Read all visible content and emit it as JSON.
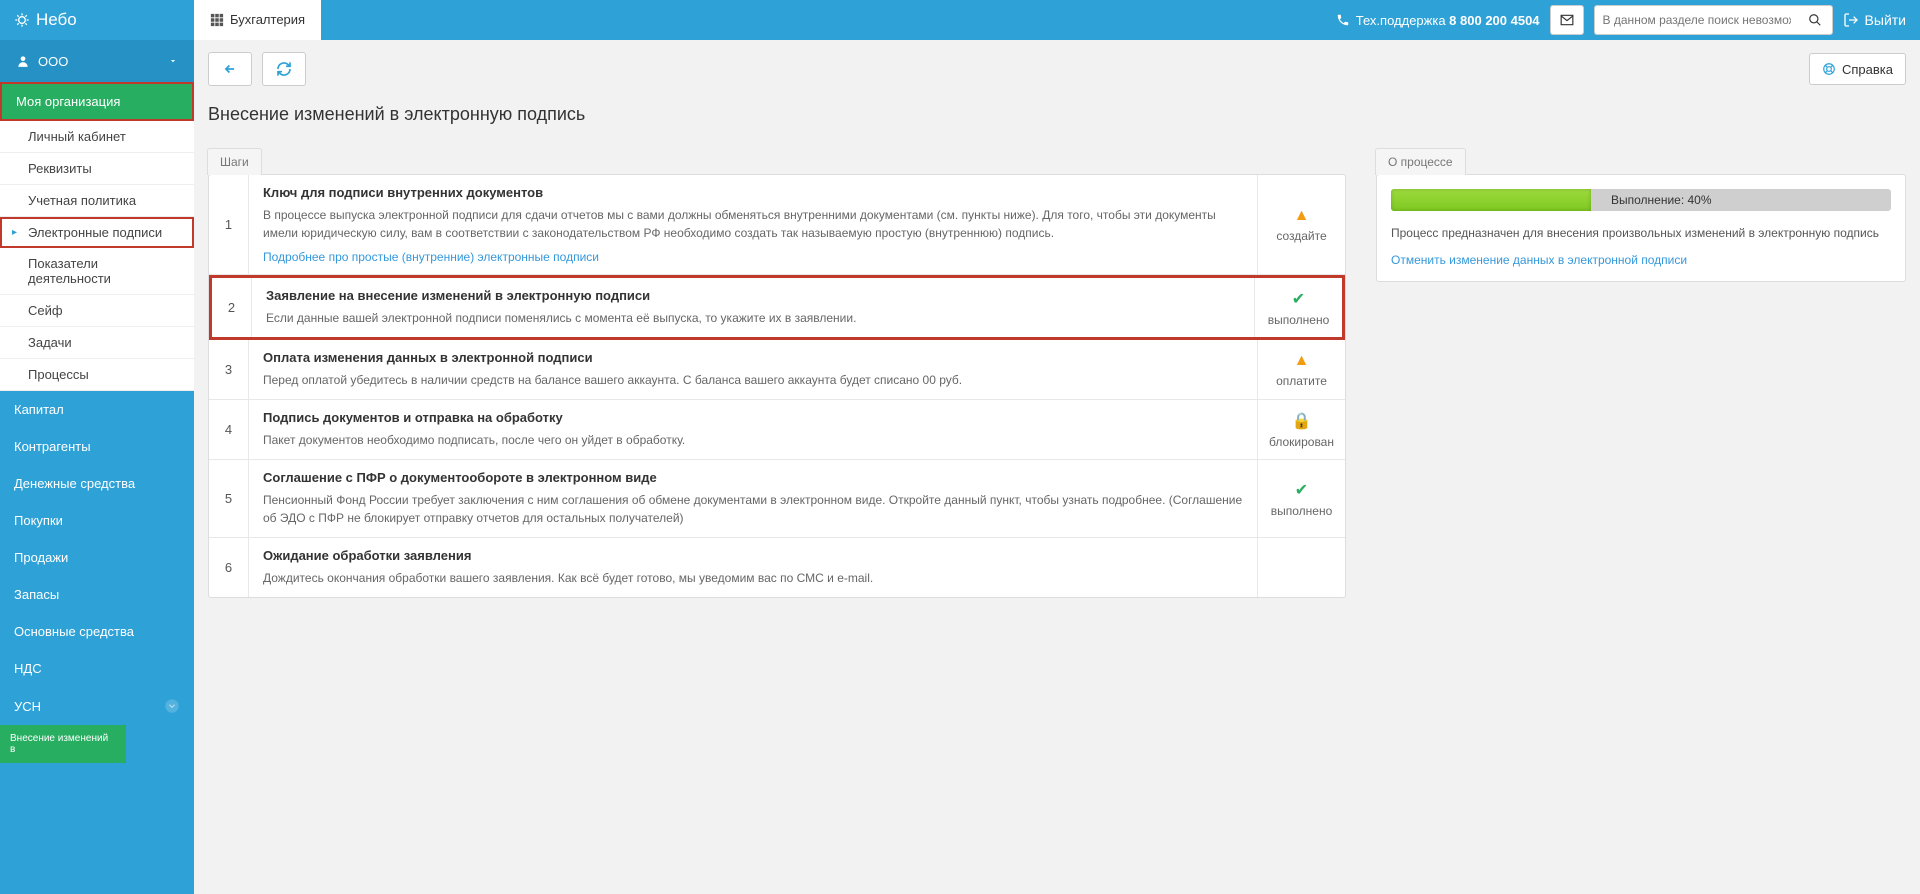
{
  "brand": "Небо",
  "topTab": "Бухгалтерия",
  "support": {
    "label": "Тех.поддержка",
    "phone": "8 800 200 4504"
  },
  "search": {
    "placeholder": "В данном разделе поиск невозможен"
  },
  "logout": "Выйти",
  "helpBtn": "Справка",
  "org": {
    "name": "ООО"
  },
  "sidebar": {
    "header": "Моя организация",
    "sub": [
      {
        "label": "Личный кабинет"
      },
      {
        "label": "Реквизиты"
      },
      {
        "label": "Учетная политика"
      },
      {
        "label": "Электронные подписи",
        "highlight": true
      },
      {
        "label": "Показатели деятельности"
      },
      {
        "label": "Сейф"
      },
      {
        "label": "Задачи"
      },
      {
        "label": "Процессы"
      }
    ],
    "links": [
      "Капитал",
      "Контрагенты",
      "Денежные средства",
      "Покупки",
      "Продажи",
      "Запасы",
      "Основные средства",
      "НДС",
      "УСН"
    ],
    "bottomBadge": "Внесение изменений в"
  },
  "page": {
    "title": "Внесение изменений в электронную подпись"
  },
  "stepsTab": "Шаги",
  "steps": [
    {
      "num": "1",
      "title": "Ключ для подписи внутренних документов",
      "text": "В процессе выпуска электронной подписи для сдачи отчетов мы с вами должны обменяться внутренними документами (см. пункты ниже). Для того, чтобы эти документы имели юридическую силу, вам в соответствии с законодательством РФ необходимо создать так называемую простую (внутреннюю) подпись.",
      "link": "Подробнее про простые (внутренние) электронные подписи",
      "status": {
        "icon": "warn",
        "label": "создайте"
      }
    },
    {
      "num": "2",
      "title": "Заявление на внесение изменений в электронную подписи",
      "text": "Если данные вашей электронной подписи поменялись с момента её выпуска, то укажите их в заявлении.",
      "status": {
        "icon": "ok",
        "label": "выполнено"
      },
      "highlight": true
    },
    {
      "num": "3",
      "title": "Оплата изменения данных в электронной подписи",
      "text": "Перед оплатой убедитесь в наличии средств на балансе вашего аккаунта. С баланса вашего аккаунта будет списано 00 руб.",
      "status": {
        "icon": "warn",
        "label": "оплатите"
      }
    },
    {
      "num": "4",
      "title": "Подпись документов и отправка на обработку",
      "text": "Пакет документов необходимо подписать, после чего он уйдет в обработку.",
      "status": {
        "icon": "lock",
        "label": "блокирован"
      }
    },
    {
      "num": "5",
      "title": "Соглашение с ПФР о документообороте в электронном виде",
      "text": "Пенсионный Фонд России требует заключения с ним соглашения об обмене документами в электронном виде. Откройте данный пункт, чтобы узнать подробнее. (Соглашение об ЭДО с ПФР не блокирует отправку отчетов для остальных получателей)",
      "status": {
        "icon": "ok",
        "label": "выполнено"
      }
    },
    {
      "num": "6",
      "title": "Ожидание обработки заявления",
      "text": "Дождитесь окончания обработки вашего заявления. Как всё будет готово, мы уведомим вас по СМС и e-mail.",
      "status": {
        "icon": "",
        "label": ""
      }
    }
  ],
  "processTab": "О процессе",
  "process": {
    "percent": 40,
    "progressLabel": "Выполнение: 40%",
    "text": "Процесс предназначен для внесения произвольных изменений в электронную подпись",
    "link": "Отменить изменение данных в электронной подписи"
  }
}
